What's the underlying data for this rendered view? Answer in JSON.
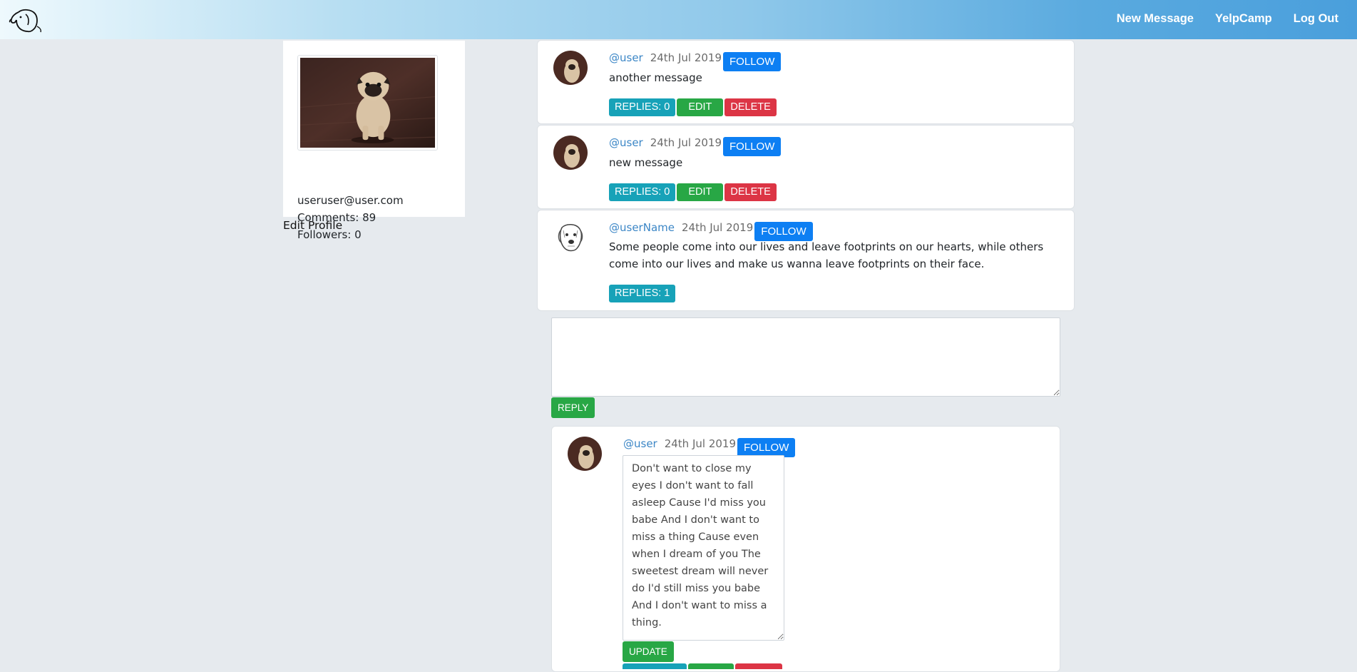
{
  "navbar": {
    "links": [
      "New Message",
      "YelpCamp",
      "Log Out"
    ],
    "logo_icon": "dog-head-icon"
  },
  "profile": {
    "email": "useruser@user.com",
    "comments": "Comments: 89",
    "followers": "Followers: 0",
    "edit_label": "Edit Profile"
  },
  "messages": [
    {
      "user": "@user",
      "date": "24th Jul 2019",
      "follow": "FOLLOW",
      "text": "another message",
      "replies": "REPLIES: 0",
      "edit": "EDIT",
      "delete": "DELETE"
    },
    {
      "user": "@user",
      "date": "24th Jul 2019",
      "follow": "FOLLOW",
      "text": "new message",
      "replies": "REPLIES: 0",
      "edit": "EDIT",
      "delete": "DELETE"
    },
    {
      "user": "@userName",
      "date": "24th Jul 2019",
      "follow": "FOLLOW",
      "text": "Some people come into our lives and leave footprints on our hearts, while others come into our lives and make us wanna leave footprints on their face.",
      "replies": "REPLIES: 1"
    }
  ],
  "reply_form": {
    "value": "",
    "button": "REPLY"
  },
  "reply": {
    "user": "@user",
    "date": "24th Jul 2019",
    "follow": "FOLLOW",
    "text": "Don't want to close my eyes I don't want to fall asleep Cause I'd miss you babe And I don't want to miss a thing Cause even when I dream of you The sweetest dream will never do I'd still miss you babe And I don't want to miss a thing.",
    "update_button": "UPDATE"
  },
  "colors": {
    "link": "#3b86c6",
    "follow": "#0d7ff3",
    "info": "#17a2b8",
    "success": "#28a745",
    "danger": "#dc3545",
    "background": "#e6eaee"
  }
}
